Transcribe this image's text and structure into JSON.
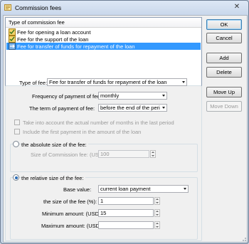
{
  "window": {
    "title": "Commission fees"
  },
  "fee_list": {
    "header": "Type of commission fee",
    "items": [
      {
        "label": "Fee for opening a loan account",
        "selected": false
      },
      {
        "label": "Fee for the support of the loan",
        "selected": false
      },
      {
        "label": "Fee for transfer of funds for repayment of the loan",
        "selected": true
      }
    ]
  },
  "buttons": {
    "ok": "OK",
    "cancel": "Cancel",
    "add": "Add",
    "delete": "Delete",
    "move_up": "Move Up",
    "move_down": "Move Down"
  },
  "form": {
    "type_of_fee_label": "Type of fee:",
    "type_of_fee_value": "Fee for transfer of funds for repayment of the loan",
    "frequency_label": "Frequency of payment of fee:",
    "frequency_value": "monthly",
    "term_label": "The term of payment of fee:",
    "term_value": "before the end of the peri",
    "take_into_account_label": "Take into account the actual number of months in the last period",
    "include_first_payment_label": "Include the first payment in the amount of the loan",
    "absolute_radio_label": "the absolute size of the fee:",
    "commission_size_label": "Size of Commission fee: (USD):",
    "commission_size_value": "100",
    "relative_radio_label": "the relative size of the fee:",
    "base_value_label": "Base value:",
    "base_value_value": "current loan payment",
    "fee_size_label": "the size of the fee (%):",
    "fee_size_value": "1",
    "min_amount_label": "Minimum amount: (USD):",
    "min_amount_value": "15",
    "max_amount_label": "Maximum amount: (USD):",
    "max_amount_value": ""
  },
  "colors": {
    "selection": "#3399ff",
    "window_frame": "#c9d6e6"
  }
}
